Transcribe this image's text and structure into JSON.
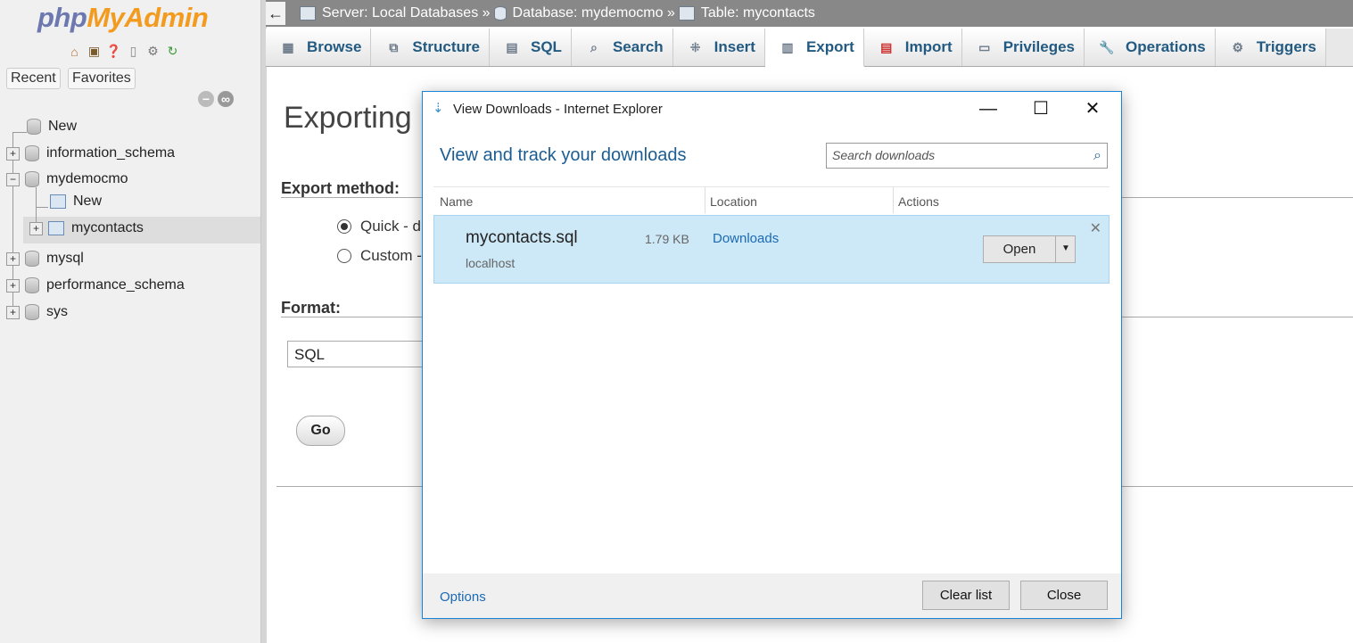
{
  "nav": {
    "logo_php": "php",
    "logo_myadmin": "MyAdmin",
    "recent": "Recent",
    "favorites": "Favorites",
    "tree": {
      "new_top": "New",
      "db1": "information_schema",
      "db2": "mydemocmo",
      "db2_new": "New",
      "db2_table": "mycontacts",
      "db3": "mysql",
      "db4": "performance_schema",
      "db5": "sys"
    },
    "icons": [
      "home-icon",
      "logout-icon",
      "help-icon",
      "docs-icon",
      "settings-icon",
      "reload-icon"
    ]
  },
  "topbar": {
    "back": "←",
    "server": "Server: Local Databases »",
    "database": "Database: mydemocmo »",
    "table": "Table: mycontacts"
  },
  "tabs": [
    {
      "label": "Browse",
      "icon": "browse-icon"
    },
    {
      "label": "Structure",
      "icon": "structure-icon"
    },
    {
      "label": "SQL",
      "icon": "sql-icon"
    },
    {
      "label": "Search",
      "icon": "search-icon"
    },
    {
      "label": "Insert",
      "icon": "insert-icon"
    },
    {
      "label": "Export",
      "icon": "export-icon",
      "active": true
    },
    {
      "label": "Import",
      "icon": "import-icon"
    },
    {
      "label": "Privileges",
      "icon": "privileges-icon"
    },
    {
      "label": "Operations",
      "icon": "operations-icon"
    },
    {
      "label": "Triggers",
      "icon": "triggers-icon"
    }
  ],
  "main": {
    "heading": "Exporting r",
    "export_method": "Export method:",
    "quick": "Quick - di",
    "custom": "Custom -",
    "format": "Format:",
    "format_value": "SQL",
    "go": "Go"
  },
  "dialog": {
    "title": "View Downloads - Internet Explorer",
    "minimize": "—",
    "maximize": "☐",
    "close_x": "✕",
    "heading": "View and track your downloads",
    "search_placeholder": "Search downloads",
    "col_name": "Name",
    "col_location": "Location",
    "col_actions": "Actions",
    "item": {
      "filename": "mycontacts.sql",
      "size": "1.79 KB",
      "host": "localhost",
      "location": "Downloads",
      "open": "Open",
      "dismiss": "✕"
    },
    "options": "Options",
    "clear_list": "Clear list",
    "close": "Close"
  },
  "colors": {
    "accent_blue": "#1b5d93",
    "selected_item_bg": "#cde8f6",
    "logo_orange": "#f29b1e",
    "logo_purple": "#6c78af"
  }
}
